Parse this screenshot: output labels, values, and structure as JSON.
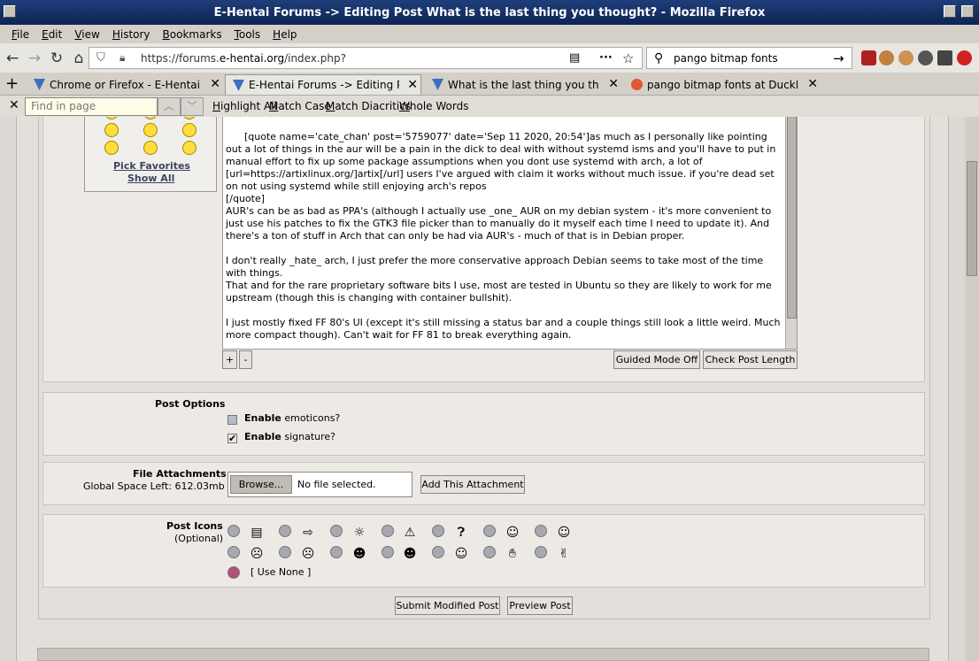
{
  "window": {
    "title": "E-Hentai Forums -> Editing Post What is the last thing you thought? - Mozilla Firefox"
  },
  "menu": [
    "File",
    "Edit",
    "View",
    "History",
    "Bookmarks",
    "Tools",
    "Help"
  ],
  "nav": {
    "url_prefix": "https://forums.",
    "url_domain": "e-hentai.org",
    "url_suffix": "/index.php?",
    "search_value": "pango bitmap fonts"
  },
  "tabs": [
    {
      "label": "Chrome or Firefox - E-Hentai Forum",
      "active": false
    },
    {
      "label": "E-Hentai Forums -> Editing Post W",
      "active": true
    },
    {
      "label": "What is the last thing you thought?",
      "active": false
    },
    {
      "label": "pango bitmap fonts at DuckDuckGo",
      "active": false
    }
  ],
  "findbar": {
    "placeholder": "Find in page",
    "options": [
      "Highlight All",
      "Match Case",
      "Match Diacritics",
      "Whole Words"
    ]
  },
  "emoticons": {
    "pick_favorites": "Pick Favorites",
    "show_all": "Show All"
  },
  "post_text": "[quote name='cate_chan' post='5759077' date='Sep 11 2020, 20:54']as much as I personally like pointing out a lot of things in the aur will be a pain in the dick to deal with without systemd isms and you'll have to put in manual effort to fix up some package assumptions when you dont use systemd with arch, a lot of [url=https://artixlinux.org/]artix[/url] users I've argued with claim it works without much issue. if you're dead set on not using systemd while still enjoying arch's repos\n[/quote]\nAUR's can be as bad as PPA's (although I actually use _one_ AUR on my debian system - it's more convenient to just use his patches to fix the GTK3 file picker than to manually do it myself each time I need to update it). And there's a ton of stuff in Arch that can only be had via AUR's - much of that is in Debian proper.\n\nI don't really _hate_ arch, I just prefer the more conservative approach Debian seems to take most of the time with things.\nThat and for the rare proprietary software bits I use, most are tested in Ubuntu so they are likely to work for me upstream (though this is changing with container bullshit).\n\nI just mostly fixed FF 80's UI (except it's still missing a status bar and a couple things still look a little weird. Much more compact though). Can't wait for FF 81 to break everything again.",
  "editor_buttons": {
    "plus": "+",
    "minus": "-",
    "guided_mode": "Guided Mode Off",
    "check_length": "Check Post Length"
  },
  "post_options": {
    "title": "Post Options",
    "emoticons_bold": "Enable",
    "emoticons_rest": " emoticons?",
    "signature_bold": "Enable",
    "signature_rest": " signature?"
  },
  "attachments": {
    "title": "File Attachments",
    "space_left": "Global Space Left: 612.03mb",
    "browse": "Browse...",
    "no_file": "No file selected.",
    "add": "Add This Attachment"
  },
  "post_icons": {
    "title": "Post Icons",
    "subtitle": "(Optional)",
    "use_none": "[ Use None ]"
  },
  "submit": {
    "submit_label": "Submit Modified Post",
    "preview_label": "Preview Post"
  }
}
